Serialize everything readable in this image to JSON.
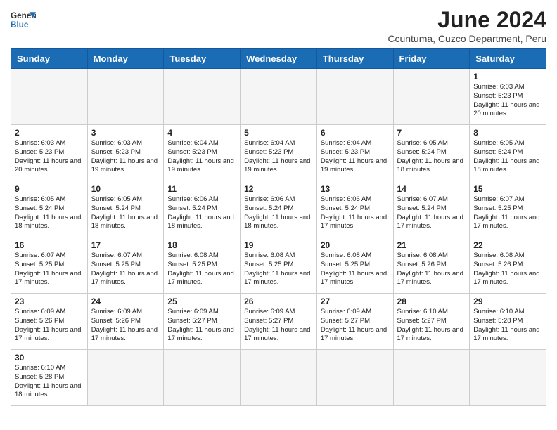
{
  "header": {
    "logo_text_normal": "General",
    "logo_text_blue": "Blue",
    "month_title": "June 2024",
    "subtitle": "Ccuntuma, Cuzco Department, Peru"
  },
  "days_of_week": [
    "Sunday",
    "Monday",
    "Tuesday",
    "Wednesday",
    "Thursday",
    "Friday",
    "Saturday"
  ],
  "weeks": [
    [
      {
        "day": "",
        "info": ""
      },
      {
        "day": "",
        "info": ""
      },
      {
        "day": "",
        "info": ""
      },
      {
        "day": "",
        "info": ""
      },
      {
        "day": "",
        "info": ""
      },
      {
        "day": "",
        "info": ""
      },
      {
        "day": "1",
        "info": "Sunrise: 6:03 AM\nSunset: 5:23 PM\nDaylight: 11 hours\nand 20 minutes."
      }
    ],
    [
      {
        "day": "2",
        "info": "Sunrise: 6:03 AM\nSunset: 5:23 PM\nDaylight: 11 hours\nand 20 minutes."
      },
      {
        "day": "3",
        "info": "Sunrise: 6:03 AM\nSunset: 5:23 PM\nDaylight: 11 hours\nand 19 minutes."
      },
      {
        "day": "4",
        "info": "Sunrise: 6:04 AM\nSunset: 5:23 PM\nDaylight: 11 hours\nand 19 minutes."
      },
      {
        "day": "5",
        "info": "Sunrise: 6:04 AM\nSunset: 5:23 PM\nDaylight: 11 hours\nand 19 minutes."
      },
      {
        "day": "6",
        "info": "Sunrise: 6:04 AM\nSunset: 5:23 PM\nDaylight: 11 hours\nand 19 minutes."
      },
      {
        "day": "7",
        "info": "Sunrise: 6:05 AM\nSunset: 5:24 PM\nDaylight: 11 hours\nand 18 minutes."
      },
      {
        "day": "8",
        "info": "Sunrise: 6:05 AM\nSunset: 5:24 PM\nDaylight: 11 hours\nand 18 minutes."
      }
    ],
    [
      {
        "day": "9",
        "info": "Sunrise: 6:05 AM\nSunset: 5:24 PM\nDaylight: 11 hours\nand 18 minutes."
      },
      {
        "day": "10",
        "info": "Sunrise: 6:05 AM\nSunset: 5:24 PM\nDaylight: 11 hours\nand 18 minutes."
      },
      {
        "day": "11",
        "info": "Sunrise: 6:06 AM\nSunset: 5:24 PM\nDaylight: 11 hours\nand 18 minutes."
      },
      {
        "day": "12",
        "info": "Sunrise: 6:06 AM\nSunset: 5:24 PM\nDaylight: 11 hours\nand 18 minutes."
      },
      {
        "day": "13",
        "info": "Sunrise: 6:06 AM\nSunset: 5:24 PM\nDaylight: 11 hours\nand 17 minutes."
      },
      {
        "day": "14",
        "info": "Sunrise: 6:07 AM\nSunset: 5:24 PM\nDaylight: 11 hours\nand 17 minutes."
      },
      {
        "day": "15",
        "info": "Sunrise: 6:07 AM\nSunset: 5:25 PM\nDaylight: 11 hours\nand 17 minutes."
      }
    ],
    [
      {
        "day": "16",
        "info": "Sunrise: 6:07 AM\nSunset: 5:25 PM\nDaylight: 11 hours\nand 17 minutes."
      },
      {
        "day": "17",
        "info": "Sunrise: 6:07 AM\nSunset: 5:25 PM\nDaylight: 11 hours\nand 17 minutes."
      },
      {
        "day": "18",
        "info": "Sunrise: 6:08 AM\nSunset: 5:25 PM\nDaylight: 11 hours\nand 17 minutes."
      },
      {
        "day": "19",
        "info": "Sunrise: 6:08 AM\nSunset: 5:25 PM\nDaylight: 11 hours\nand 17 minutes."
      },
      {
        "day": "20",
        "info": "Sunrise: 6:08 AM\nSunset: 5:25 PM\nDaylight: 11 hours\nand 17 minutes."
      },
      {
        "day": "21",
        "info": "Sunrise: 6:08 AM\nSunset: 5:26 PM\nDaylight: 11 hours\nand 17 minutes."
      },
      {
        "day": "22",
        "info": "Sunrise: 6:08 AM\nSunset: 5:26 PM\nDaylight: 11 hours\nand 17 minutes."
      }
    ],
    [
      {
        "day": "23",
        "info": "Sunrise: 6:09 AM\nSunset: 5:26 PM\nDaylight: 11 hours\nand 17 minutes."
      },
      {
        "day": "24",
        "info": "Sunrise: 6:09 AM\nSunset: 5:26 PM\nDaylight: 11 hours\nand 17 minutes."
      },
      {
        "day": "25",
        "info": "Sunrise: 6:09 AM\nSunset: 5:27 PM\nDaylight: 11 hours\nand 17 minutes."
      },
      {
        "day": "26",
        "info": "Sunrise: 6:09 AM\nSunset: 5:27 PM\nDaylight: 11 hours\nand 17 minutes."
      },
      {
        "day": "27",
        "info": "Sunrise: 6:09 AM\nSunset: 5:27 PM\nDaylight: 11 hours\nand 17 minutes."
      },
      {
        "day": "28",
        "info": "Sunrise: 6:10 AM\nSunset: 5:27 PM\nDaylight: 11 hours\nand 17 minutes."
      },
      {
        "day": "29",
        "info": "Sunrise: 6:10 AM\nSunset: 5:28 PM\nDaylight: 11 hours\nand 17 minutes."
      }
    ],
    [
      {
        "day": "30",
        "info": "Sunrise: 6:10 AM\nSunset: 5:28 PM\nDaylight: 11 hours\nand 18 minutes."
      },
      {
        "day": "",
        "info": ""
      },
      {
        "day": "",
        "info": ""
      },
      {
        "day": "",
        "info": ""
      },
      {
        "day": "",
        "info": ""
      },
      {
        "day": "",
        "info": ""
      },
      {
        "day": "",
        "info": ""
      }
    ]
  ]
}
